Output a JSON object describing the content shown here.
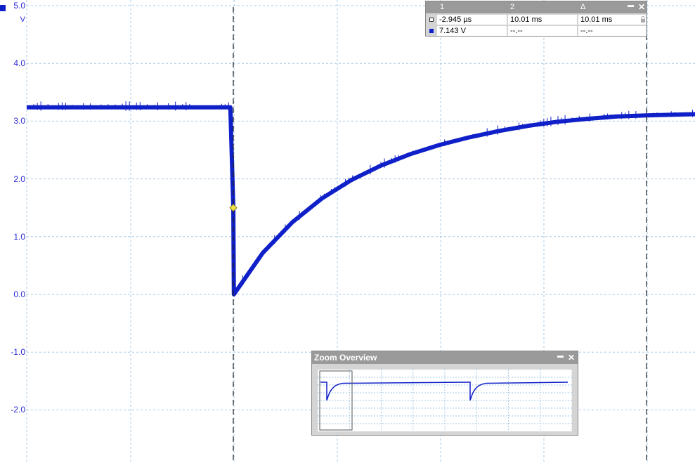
{
  "axis": {
    "unit": "V",
    "y_ticks": [
      "5.0",
      "4.0",
      "3.0",
      "2.0",
      "1.0",
      "0.0",
      "-1.0",
      "-2.0"
    ]
  },
  "colors": {
    "trace": "#1020c8",
    "grid": "#a7c8e4",
    "trigger_marker": "#f2e24a",
    "panel_header": "#9a9a9a"
  },
  "cursor_table": {
    "headers": [
      "1",
      "2",
      "Δ"
    ],
    "rows": [
      [
        "-2.945 µs",
        "10.01 ms",
        "10.01 ms"
      ],
      [
        "7.143 V",
        "--.--",
        "--.--"
      ]
    ],
    "minimize_label": "▬",
    "close_label": "✕"
  },
  "zoom_overview": {
    "title": "Zoom Overview",
    "minimize_label": "▬",
    "close_label": "✕"
  },
  "chart_data": {
    "type": "line",
    "title": "",
    "xlabel": "",
    "ylabel": "V",
    "ylim": [
      -2.9,
      5.0
    ],
    "grid": true,
    "series": [
      {
        "points": [
          [
            -3.5,
            3.24
          ],
          [
            -3.0,
            3.24
          ],
          [
            -2.0,
            3.24
          ],
          [
            -1.0,
            3.24
          ],
          [
            -0.05,
            3.24
          ],
          [
            0.0,
            1.5
          ],
          [
            0.01,
            0.0
          ],
          [
            0.5,
            0.72
          ],
          [
            1.0,
            1.25
          ],
          [
            1.5,
            1.66
          ],
          [
            2.0,
            1.98
          ],
          [
            2.5,
            2.23
          ],
          [
            3.0,
            2.43
          ],
          [
            3.5,
            2.59
          ],
          [
            4.0,
            2.72
          ],
          [
            4.5,
            2.83
          ],
          [
            5.0,
            2.92
          ],
          [
            5.5,
            2.99
          ],
          [
            6.0,
            3.04
          ],
          [
            6.5,
            3.08
          ],
          [
            7.0,
            3.1
          ],
          [
            7.85,
            3.12
          ]
        ]
      }
    ],
    "cursors": [
      0.0,
      7.0
    ],
    "trigger_level": 1.5
  }
}
